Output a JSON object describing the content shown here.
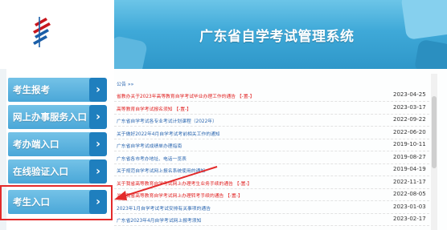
{
  "header": {
    "title": "广东省自学考试管理系统"
  },
  "sidebar": {
    "items": [
      {
        "label": "考生报考"
      },
      {
        "label": "网上办事服务入口"
      },
      {
        "label": "考办端入口"
      },
      {
        "label": "在线验证入口"
      },
      {
        "label": "考生入口"
      }
    ],
    "arrow_glyph": "›"
  },
  "notices": {
    "heading": "公告 »»",
    "rows": [
      {
        "title": "省教办关于2023年高等教育自学考试毕业办理工作的通告 【-置-】",
        "date": "2023-04-25",
        "color": "red"
      },
      {
        "title": "高等教育自学考试报名须知 【-置-】",
        "date": "2023-03-17",
        "color": "red"
      },
      {
        "title": "广东省自学考试各专业考试计划课程（2022年）",
        "date": "2022-09-22",
        "color": "blue"
      },
      {
        "title": "关于做好2022年4月自学考试考前相关工作的通知",
        "date": "2022-06-20",
        "color": "blue"
      },
      {
        "title": "广东省自学考试成绩单办理指南",
        "date": "2019-10-11",
        "color": "blue"
      },
      {
        "title": "广东省各市考办地址、电话一览表",
        "date": "2019-08-27",
        "color": "blue"
      },
      {
        "title": "关于规范自学考试网上报名系统使用的通知",
        "date": "2019-04-19",
        "color": "blue"
      },
      {
        "title": "关于我省高等教育自学考试网上办理考生业务手续的通告 【-置-】",
        "date": "2022-11-17",
        "color": "red"
      },
      {
        "title": "关于我省高等教育自学考试网上办理转考手续的通告 【-置-】",
        "date": "2022-08-05",
        "color": "red"
      },
      {
        "title": "2023年1月自学考试考试安排有关事项的通告",
        "date": "2023-01-03",
        "color": "blue"
      },
      {
        "title": "广东省2023年4月自学考试网上报考须知",
        "date": "2023-02-17",
        "color": "blue"
      }
    ]
  },
  "colors": {
    "banner": "#3fa9d8",
    "nav": "#4aa7d8",
    "nav_arrow": "#1f7fbe",
    "annotation": "#e32a2a",
    "notice_red": "#e02020",
    "notice_blue": "#2b66b0"
  },
  "icons": [
    "logo-icon",
    "chevron-right-icon"
  ]
}
